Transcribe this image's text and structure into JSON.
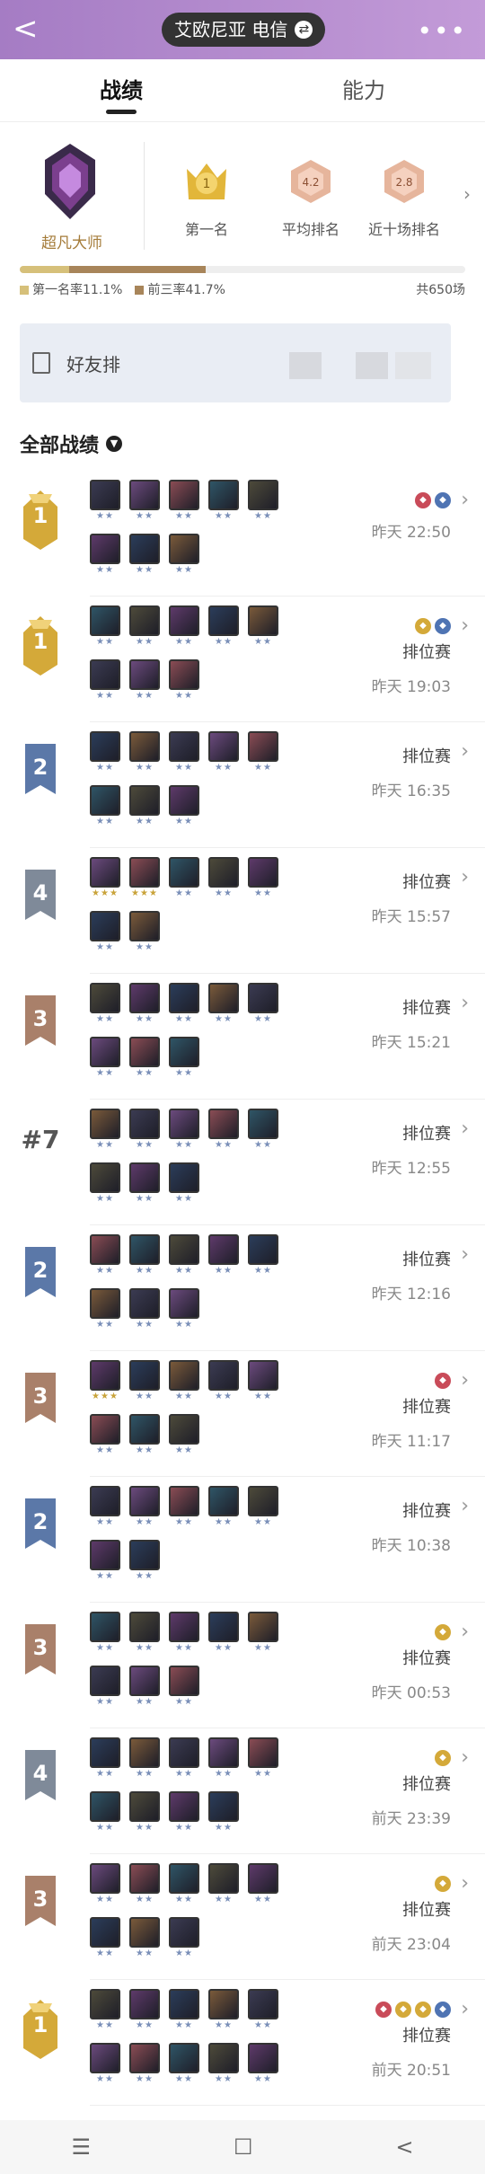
{
  "header": {
    "back": "<",
    "server": "艾欧尼亚 电信",
    "swap_icon": "⇄",
    "more": "•••"
  },
  "tabs": [
    {
      "label": "战绩",
      "active": true
    },
    {
      "label": "能力",
      "active": false
    }
  ],
  "summary": {
    "rank_name": "超凡大师",
    "stats": [
      {
        "label": "第一名",
        "value": "1",
        "badge_color": "#e2b63a"
      },
      {
        "label": "平均排名",
        "value": "4.2",
        "badge_color": "#e6b59c"
      },
      {
        "label": "近十场排名",
        "value": "2.8",
        "badge_color": "#e6b59c"
      }
    ],
    "first_rate": "第一名率11.1%",
    "top3_rate": "前三率41.7%",
    "first_rate_value": 0.111,
    "top3_rate_value": 0.417,
    "total": "共650场"
  },
  "friend_rank": {
    "label": "好友排"
  },
  "section_title": "全部战绩",
  "matches": [
    {
      "place": "1",
      "style": "gold",
      "mode": "",
      "time": "昨天 22:50",
      "augs": [
        "#c94b59",
        "#4f74b3"
      ],
      "rows": [
        5,
        3
      ],
      "gold": []
    },
    {
      "place": "1",
      "style": "gold",
      "mode": "排位赛",
      "time": "昨天 19:03",
      "augs": [
        "#d4a939",
        "#4f74b3"
      ],
      "rows": [
        5,
        3
      ],
      "gold": []
    },
    {
      "place": "2",
      "style": "blue",
      "mode": "排位赛",
      "time": "昨天 16:35",
      "augs": [],
      "rows": [
        5,
        3
      ],
      "gold": []
    },
    {
      "place": "4",
      "style": "grey",
      "mode": "排位赛",
      "time": "昨天 15:57",
      "augs": [],
      "rows": [
        5,
        2
      ],
      "gold": [
        0,
        1
      ]
    },
    {
      "place": "3",
      "style": "bronze",
      "mode": "排位赛",
      "time": "昨天 15:21",
      "augs": [],
      "rows": [
        5,
        3
      ],
      "gold": []
    },
    {
      "place": "#7",
      "style": "plain",
      "mode": "排位赛",
      "time": "昨天 12:55",
      "augs": [],
      "rows": [
        5,
        3
      ],
      "gold": []
    },
    {
      "place": "2",
      "style": "blue",
      "mode": "排位赛",
      "time": "昨天 12:16",
      "augs": [],
      "rows": [
        5,
        3
      ],
      "gold": []
    },
    {
      "place": "3",
      "style": "bronze",
      "mode": "排位赛",
      "time": "昨天 11:17",
      "augs": [
        "#c94b59"
      ],
      "rows": [
        5,
        3
      ],
      "gold": [
        0
      ]
    },
    {
      "place": "2",
      "style": "blue",
      "mode": "排位赛",
      "time": "昨天 10:38",
      "augs": [],
      "rows": [
        5,
        2
      ],
      "gold": []
    },
    {
      "place": "3",
      "style": "bronze",
      "mode": "排位赛",
      "time": "昨天 00:53",
      "augs": [
        "#d4a939"
      ],
      "rows": [
        5,
        3
      ],
      "gold": []
    },
    {
      "place": "4",
      "style": "grey",
      "mode": "排位赛",
      "time": "前天 23:39",
      "augs": [
        "#d4a939"
      ],
      "rows": [
        5,
        4
      ],
      "gold": []
    },
    {
      "place": "3",
      "style": "bronze",
      "mode": "排位赛",
      "time": "前天 23:04",
      "augs": [
        "#d4a939"
      ],
      "rows": [
        5,
        3
      ],
      "gold": []
    },
    {
      "place": "1",
      "style": "gold",
      "mode": "排位赛",
      "time": "前天 20:51",
      "augs": [
        "#c94b59",
        "#d4a939",
        "#d4a939",
        "#4f74b3"
      ],
      "rows": [
        5,
        5
      ],
      "gold": []
    }
  ],
  "nav": [
    "☰",
    "☐",
    "<"
  ],
  "colors": {
    "header": "#b48bcf",
    "gold": "#d4a939",
    "blue": "#5b78a8",
    "grey": "#7f8a99",
    "bronze": "#a9806a"
  }
}
